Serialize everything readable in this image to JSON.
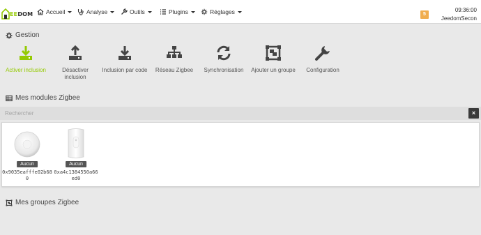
{
  "navbar": {
    "brand": "JEEDOM",
    "menus": [
      {
        "label": "Accueil",
        "icon": "home-icon"
      },
      {
        "label": "Analyse",
        "icon": "stethoscope-icon"
      },
      {
        "label": "Outils",
        "icon": "wrench-icon"
      },
      {
        "label": "Plugins",
        "icon": "list-icon"
      },
      {
        "label": "Réglages",
        "icon": "gears-icon"
      }
    ],
    "notification_count": "5",
    "time": "09:36:00",
    "hostname": "JeedomSecon"
  },
  "gestion": {
    "title": "Gestion",
    "actions": [
      {
        "label": "Activer inclusion",
        "icon": "download-icon",
        "active": true
      },
      {
        "label": "Désactiver inclusion",
        "icon": "upload-icon",
        "active": false
      },
      {
        "label": "Inclusion par code",
        "icon": "download-tray-icon",
        "active": false
      },
      {
        "label": "Réseau Zigbee",
        "icon": "sitemap-icon",
        "active": false
      },
      {
        "label": "Synchronisation",
        "icon": "sync-icon",
        "active": false
      },
      {
        "label": "Ajouter un groupe",
        "icon": "object-group-icon",
        "active": false
      },
      {
        "label": "Configuration",
        "icon": "wrench-icon",
        "active": false
      }
    ]
  },
  "modules": {
    "title": "Mes modules Zigbee",
    "search_placeholder": "Rechercher",
    "clear_label": "×",
    "items": [
      {
        "name": "0x9035eafffe02b680",
        "badge": "Aucun"
      },
      {
        "name": "0xa4c1384550a66ed0",
        "badge": "Aucun"
      }
    ]
  },
  "groups": {
    "title": "Mes groupes Zigbee"
  },
  "colors": {
    "accent": "#94ca02",
    "icon": "#444444",
    "badge": "#f0ad4e"
  }
}
